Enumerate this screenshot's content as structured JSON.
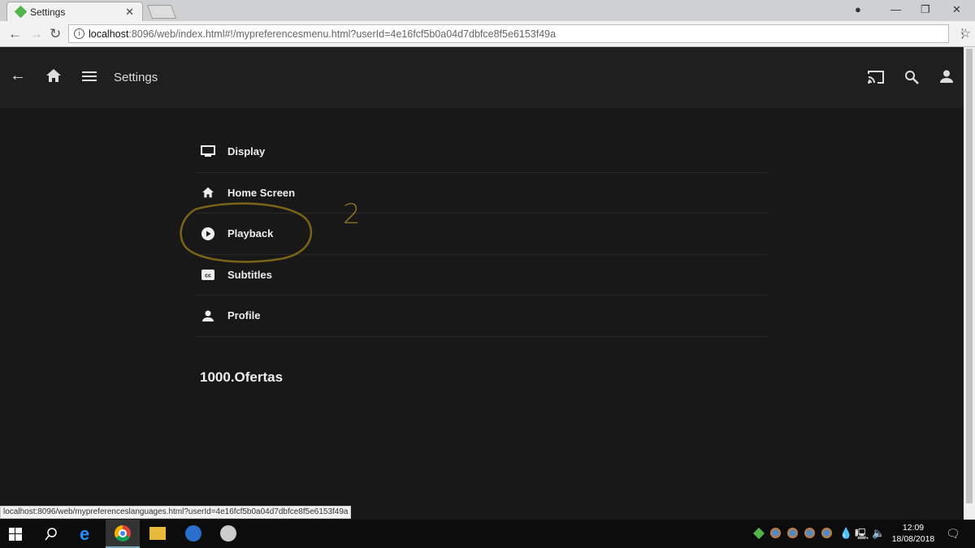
{
  "browser": {
    "tab_title": "Settings",
    "url_host": "localhost",
    "url_rest": ":8096/web/index.html#!/mypreferencesmenu.html?userId=4e16fcf5b0a04d7dbfce8f5e6153f49a",
    "status_url": "localhost:8096/web/mypreferenceslanguages.html?userId=4e16fcf5b0a04d7dbfce8f5e6153f49a"
  },
  "header": {
    "title": "Settings"
  },
  "menu": [
    {
      "label": "Display",
      "icon": "monitor-icon"
    },
    {
      "label": "Home Screen",
      "icon": "home-icon"
    },
    {
      "label": "Playback",
      "icon": "play-circle-icon"
    },
    {
      "label": "Subtitles",
      "icon": "closed-caption-icon"
    },
    {
      "label": "Profile",
      "icon": "person-icon"
    }
  ],
  "brand": "1000.Ofertas",
  "annotation": {
    "number": "2",
    "color": "#8a7020"
  },
  "taskbar": {
    "time": "12:09",
    "date": "18/08/2018"
  }
}
